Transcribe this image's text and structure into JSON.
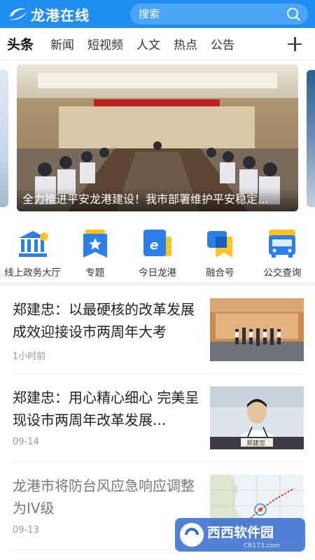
{
  "header": {
    "app_name": "龙港在线",
    "search_placeholder": "搜索"
  },
  "tabs": [
    {
      "label": "头条",
      "active": true
    },
    {
      "label": "新闻"
    },
    {
      "label": "短视频"
    },
    {
      "label": "人文"
    },
    {
      "label": "热点"
    },
    {
      "label": "公告"
    }
  ],
  "carousel": {
    "caption": "全力推进平安龙港建设！我市部署维护平安稳定..."
  },
  "quick_actions": [
    {
      "label": "线上政务大厅",
      "icon": "government-hall-icon"
    },
    {
      "label": "专题",
      "icon": "topic-star-icon"
    },
    {
      "label": "今日龙港",
      "icon": "today-longgang-icon"
    },
    {
      "label": "融合号",
      "icon": "fusion-account-icon"
    },
    {
      "label": "公交查询",
      "icon": "bus-icon"
    }
  ],
  "news": [
    {
      "title": "郑建忠：以最硬核的改革发展成效迎接设市两周年大考",
      "time": "1小时前"
    },
    {
      "title": "郑建忠：用心精心细心 完美呈现设市两周年改革发展...",
      "time": "09-14",
      "thumb_text": "郑建忠"
    },
    {
      "title": "龙港市将防台风应急响应调整为IV级",
      "time": "09-13"
    }
  ],
  "watermark": {
    "text": "西西软件园",
    "url_text": "CR173.com"
  },
  "colors": {
    "header_bg": "#1f8ef0",
    "search_bg": "#4aa6f5",
    "icon_blue": "#2c7fe8",
    "icon_yellow": "#ffc21a"
  }
}
